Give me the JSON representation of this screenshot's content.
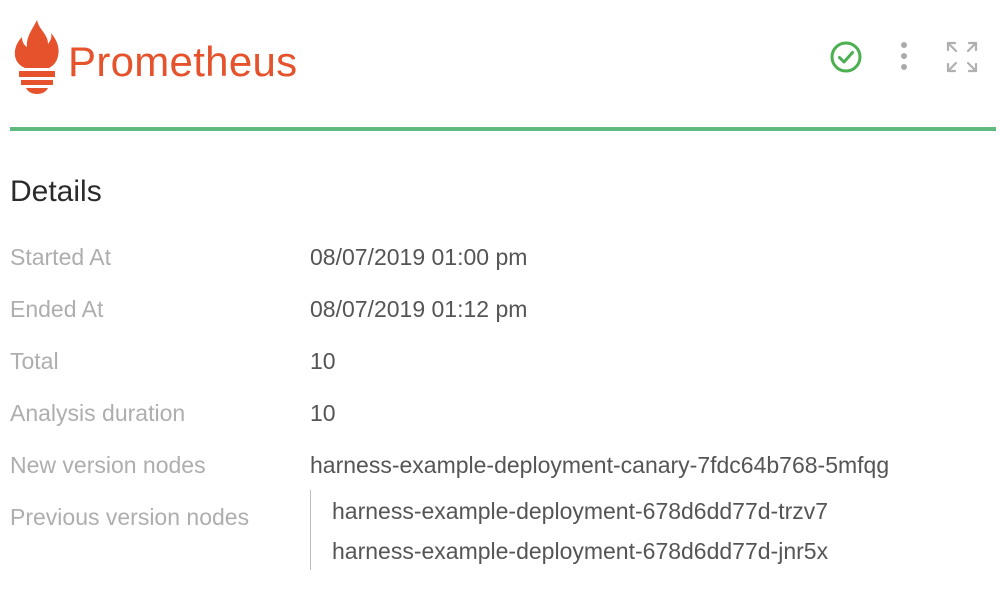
{
  "header": {
    "brand": "Prometheus",
    "logo_icon": "prometheus-logo-icon",
    "status_icon": "check-circle-icon",
    "more_icon": "vertical-ellipsis-icon",
    "expand_icon": "expand-icon",
    "brand_color": "#e6522c",
    "status_color": "#4caf50",
    "divider_color": "#5fba7d"
  },
  "details": {
    "title": "Details",
    "rows": [
      {
        "label": "Started At",
        "value": "08/07/2019 01:00 pm"
      },
      {
        "label": "Ended At",
        "value": "08/07/2019 01:12 pm"
      },
      {
        "label": "Total",
        "value": "10"
      },
      {
        "label": "Analysis duration",
        "value": "10"
      },
      {
        "label": "New version nodes",
        "value": "harness-example-deployment-canary-7fdc64b768-5mfqg"
      }
    ],
    "previous": {
      "label": "Previous version nodes",
      "nodes": [
        "harness-example-deployment-678d6dd77d-trzv7",
        "harness-example-deployment-678d6dd77d-jnr5x"
      ]
    }
  }
}
